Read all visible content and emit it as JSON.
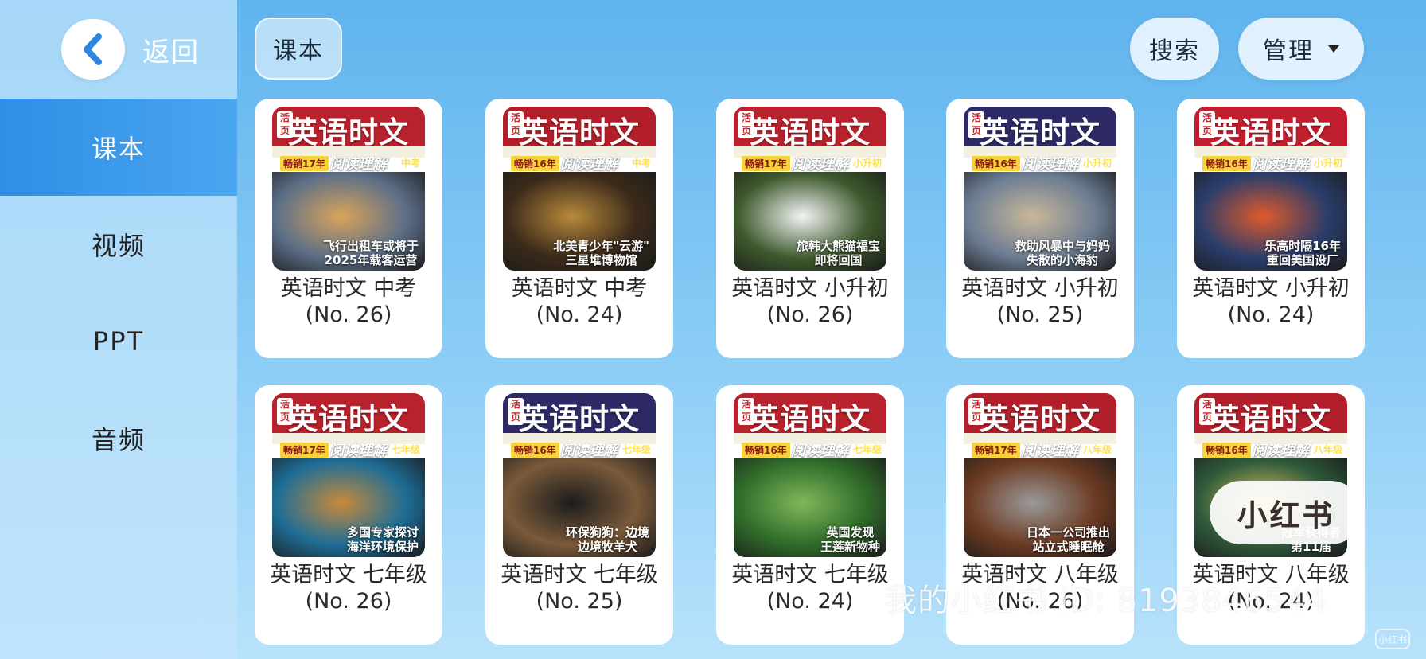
{
  "sidebar": {
    "back_label": "返回",
    "items": [
      {
        "label": "课本",
        "active": true
      },
      {
        "label": "视频",
        "active": false
      },
      {
        "label": "PPT",
        "active": false
      },
      {
        "label": "音频",
        "active": false
      }
    ]
  },
  "header": {
    "category_chip": "课本",
    "search_label": "搜索",
    "manage_label": "管理"
  },
  "cover_common": {
    "series_title": "英语时文",
    "reading_label": "阅读理解",
    "qian_tag": "活页"
  },
  "books": [
    {
      "title": "英语时文 中考",
      "issue": "(No. 26)",
      "sales": "畅销17年",
      "grade": "中考",
      "headline": "飞行出租车或将于\n2025年载客运营",
      "top_color": "#b8222c",
      "scene_color": "#5d6f88",
      "scene_accent": "#d9a45a"
    },
    {
      "title": "英语时文 中考",
      "issue": "(No. 24)",
      "sales": "畅销16年",
      "grade": "中考",
      "headline": "北美青少年\"云游\"\n三星堆博物馆",
      "top_color": "#b21f2a",
      "scene_color": "#3b2a1a",
      "scene_accent": "#b88a3c"
    },
    {
      "title": "英语时文 小升初",
      "issue": "(No. 26)",
      "sales": "畅销17年",
      "grade": "小升初",
      "headline": "旅韩大熊猫福宝\n即将回国",
      "top_color": "#b8222c",
      "scene_color": "#3e5a2e",
      "scene_accent": "#f4f4f4"
    },
    {
      "title": "英语时文 小升初",
      "issue": "(No. 25)",
      "sales": "畅销16年",
      "grade": "小升初",
      "headline": "救助风暴中与妈妈\n失散的小海豹",
      "top_color": "#2d2a66",
      "scene_color": "#6b7c92",
      "scene_accent": "#c9b89a"
    },
    {
      "title": "英语时文 小升初",
      "issue": "(No. 24)",
      "sales": "畅销16年",
      "grade": "小升初",
      "headline": "乐高时隔16年\n重回美国设厂",
      "top_color": "#c21f2e",
      "scene_color": "#2a3d6b",
      "scene_accent": "#e05a2a"
    },
    {
      "title": "英语时文 七年级",
      "issue": "(No. 26)",
      "sales": "畅销17年",
      "grade": "七年级",
      "headline": "多国专家探讨\n海洋环境保护",
      "top_color": "#b8222c",
      "scene_color": "#1e6d96",
      "scene_accent": "#c98a3a"
    },
    {
      "title": "英语时文 七年级",
      "issue": "(No. 25)",
      "sales": "畅销16年",
      "grade": "七年级",
      "headline": "环保狗狗：边境\n边境牧羊犬",
      "top_color": "#2d2a66",
      "scene_color": "#7a5a3a",
      "scene_accent": "#1c1c1c"
    },
    {
      "title": "英语时文 七年级",
      "issue": "(No. 24)",
      "sales": "畅销16年",
      "grade": "七年级",
      "headline": "英国发现\n王莲新物种",
      "top_color": "#b8222c",
      "scene_color": "#2f6a2a",
      "scene_accent": "#7fb85a"
    },
    {
      "title": "英语时文 八年级",
      "issue": "(No. 26)",
      "sales": "畅销17年",
      "grade": "八年级",
      "headline": "日本一公司推出\n站立式睡眠舱",
      "top_color": "#b21f2a",
      "scene_color": "#6b3a22",
      "scene_accent": "#9a9a9a"
    },
    {
      "title": "英语时文 八年级",
      "issue": "(No. 24)",
      "sales": "畅销16年",
      "grade": "八年级",
      "headline": "冠军获得者\n第11届",
      "top_color": "#b21f2a",
      "scene_color": "#2f5a3a",
      "scene_accent": "#d8c060"
    }
  ],
  "watermark": {
    "text": "我的小红书 ID: 8193846544",
    "logo": "小红书",
    "corner": "小红书"
  }
}
